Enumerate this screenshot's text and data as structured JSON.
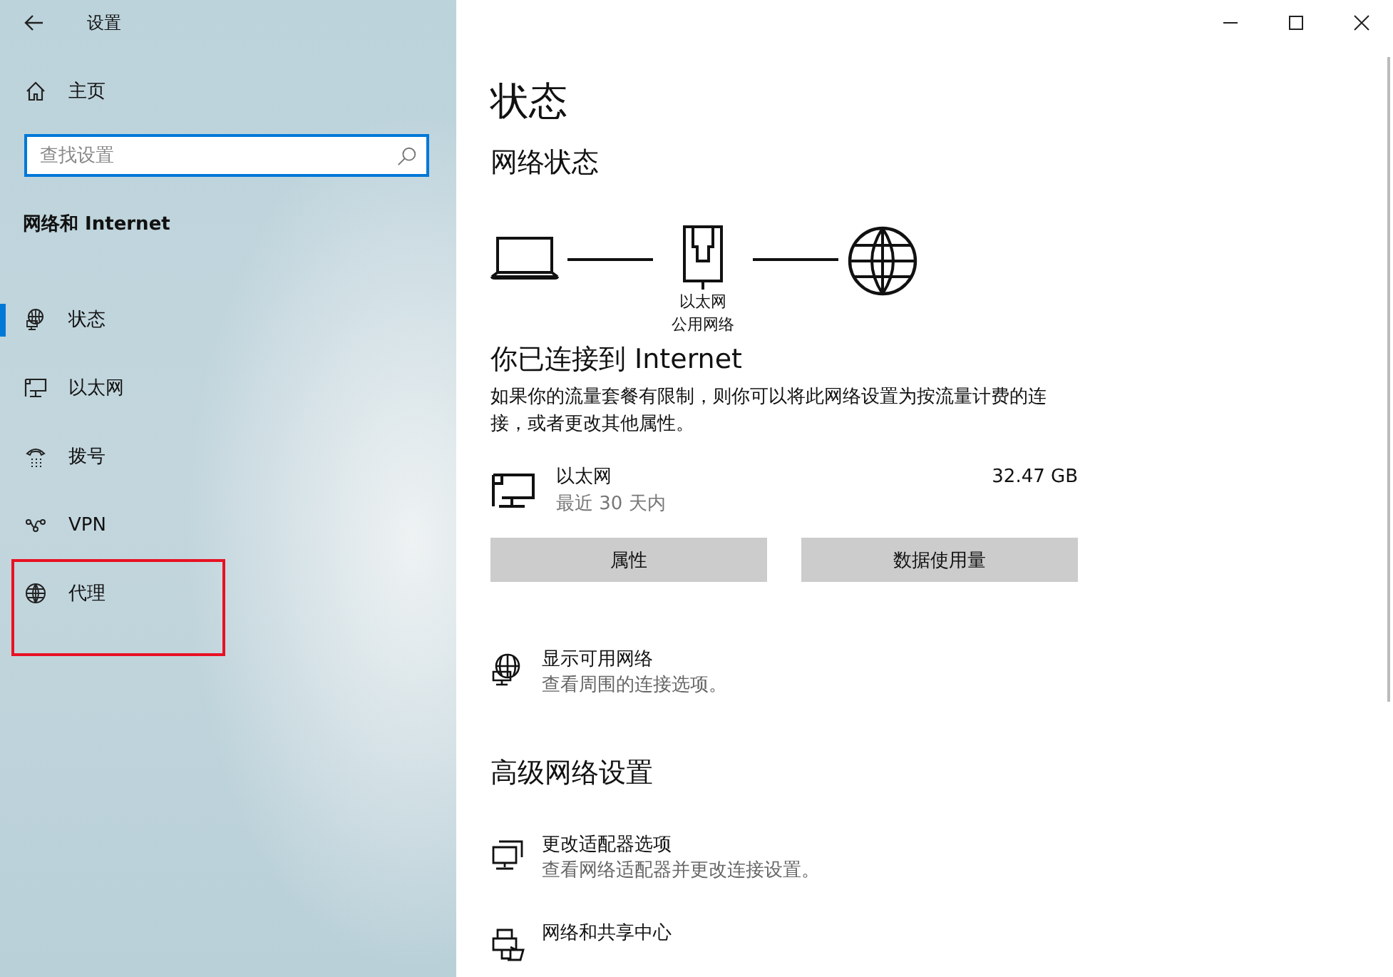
{
  "window": {
    "title": "设置"
  },
  "sidebar": {
    "home": "主页",
    "search": {
      "placeholder": "查找设置"
    },
    "section": "网络和 Internet",
    "items": [
      {
        "label": "状态",
        "kind": "status",
        "selected": true,
        "highlighted": false
      },
      {
        "label": "以太网",
        "kind": "ethernet",
        "selected": false,
        "highlighted": false
      },
      {
        "label": "拨号",
        "kind": "dialup",
        "selected": false,
        "highlighted": false
      },
      {
        "label": "VPN",
        "kind": "vpn",
        "selected": false,
        "highlighted": false
      },
      {
        "label": "代理",
        "kind": "proxy",
        "selected": false,
        "highlighted": true
      }
    ]
  },
  "main": {
    "title": "状态",
    "network_status": {
      "heading": "网络状态",
      "adapter_label": "以太网",
      "network_type": "公用网络"
    },
    "connected_heading": "你已连接到 Internet",
    "description": "如果你的流量套餐有限制，则你可以将此网络设置为按流量计费的连接，或者更改其他属性。",
    "connection": {
      "name": "以太网",
      "period": "最近 30 天内",
      "usage": "32.47 GB"
    },
    "buttons": [
      "属性",
      "数据使用量"
    ],
    "show_networks": {
      "title": "显示可用网络",
      "subtitle": "查看周围的连接选项。"
    },
    "advanced_heading": "高级网络设置",
    "advanced": [
      {
        "kind": "adapter",
        "title": "更改适配器选项",
        "subtitle": "查看网络适配器并更改连接设置。"
      },
      {
        "kind": "sharing",
        "title": "网络和共享中心"
      }
    ]
  }
}
